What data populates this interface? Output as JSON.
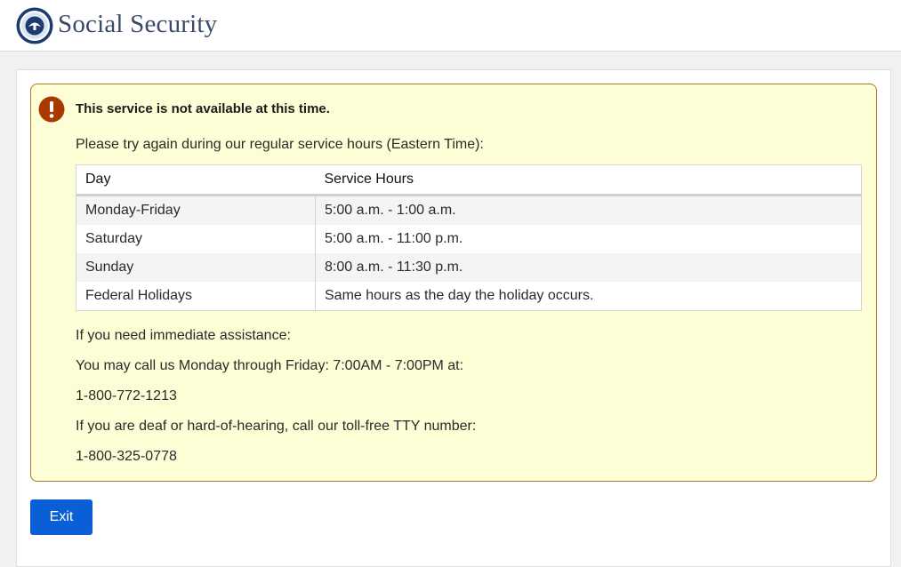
{
  "header": {
    "brand": "Social Security",
    "logo_icon": "ssa-seal-icon"
  },
  "alert": {
    "icon": "exclamation-circle-icon",
    "icon_color": "#a83a00",
    "title": "This service is not available at this time.",
    "intro": "Please try again during our regular service hours (Eastern Time):",
    "table": {
      "headers": [
        "Day",
        "Service Hours"
      ],
      "rows": [
        [
          "Monday-Friday",
          "5:00 a.m. - 1:00 a.m."
        ],
        [
          "Saturday",
          "5:00 a.m. - 11:00 p.m."
        ],
        [
          "Sunday",
          "8:00 a.m. - 11:30 p.m."
        ],
        [
          "Federal Holidays",
          "Same hours as the day the holiday occurs."
        ]
      ]
    },
    "assist_heading": "If you need immediate assistance:",
    "call_text": "You may call us Monday through Friday: 7:00AM - 7:00PM at:",
    "phone": "1-800-772-1213",
    "tty_text": "If you are deaf or hard-of-hearing, call our toll-free TTY number:",
    "tty_phone": "1-800-325-0778"
  },
  "actions": {
    "exit_label": "Exit"
  },
  "colors": {
    "brand": "#3b4a6b",
    "alert_bg": "#fdfdd6",
    "alert_border": "#a9772e",
    "button": "#0b5fd6"
  }
}
